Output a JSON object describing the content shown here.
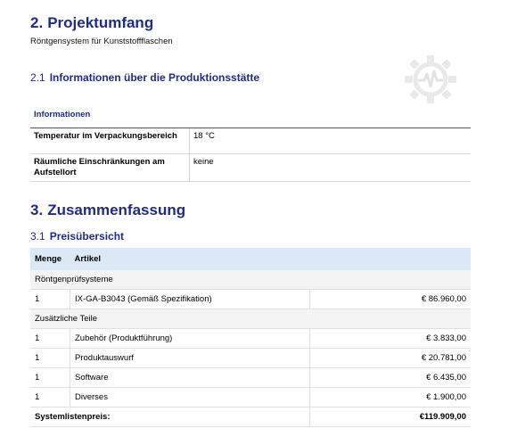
{
  "section2": {
    "number": "2.",
    "title": "Projektumfang",
    "subtitle": "Röntgensystem für Kunststoffflaschen",
    "sub1": {
      "number": "2.1",
      "title": "Informationen über die Produktionsstätte"
    },
    "info_table": {
      "header": "Informationen",
      "rows": [
        {
          "label": "Temperatur im Verpackungsbereich",
          "value": "18 °C"
        },
        {
          "label": "Räumliche Einschränkungen am Aufstellort",
          "value": "keine"
        }
      ]
    }
  },
  "section3": {
    "number": "3.",
    "title": "Zusammenfassung",
    "sub1": {
      "number": "3.1",
      "title": "Preisübersicht"
    },
    "price_table": {
      "col_qty": "Menge",
      "col_article": "Artikel",
      "groups": [
        {
          "name": "Röntgenprüfsysteme",
          "items": [
            {
              "qty": "1",
              "article": "IX-GA-B3043 (Gemäß Spezifikation)",
              "price": "€ 86.960,00"
            }
          ]
        },
        {
          "name": "Zusätzliche Teile",
          "items": [
            {
              "qty": "1",
              "article": "Zubehör (Produktführung)",
              "price": "€ 3.833,00"
            },
            {
              "qty": "1",
              "article": "Produktauswurf",
              "price": "€ 20.781,00"
            },
            {
              "qty": "1",
              "article": "Software",
              "price": "€ 6.435,00"
            },
            {
              "qty": "1",
              "article": "Diverses",
              "price": "€ 1.900,00"
            }
          ]
        }
      ],
      "total_label": "Systemlistenpreis:",
      "total_value": "€119.909,00"
    }
  },
  "logo_icon": "gear-heartbeat-icon",
  "colors": {
    "heading": "#1f2b88",
    "table_header_bg": "#dbe8f6",
    "group_bg": "#f4f4f4"
  }
}
